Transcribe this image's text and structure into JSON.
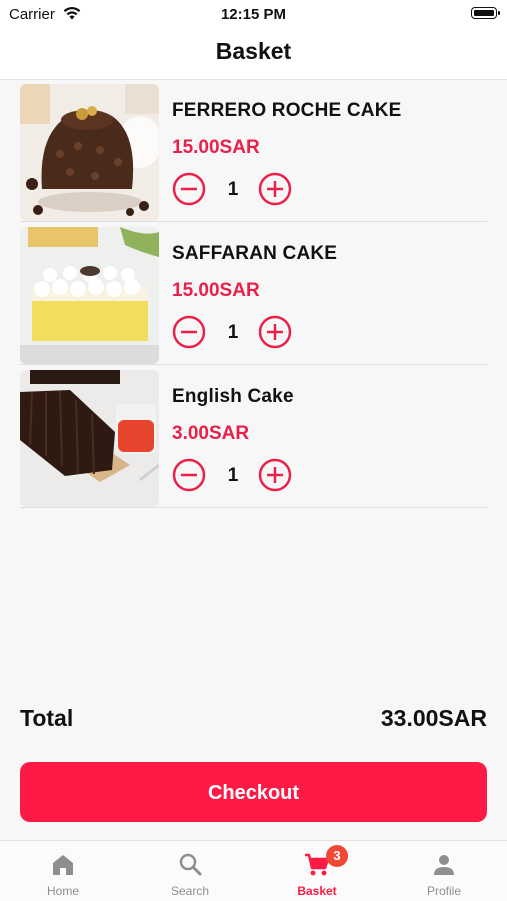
{
  "status_bar": {
    "carrier": "Carrier",
    "time": "12:15 PM"
  },
  "header": {
    "title": "Basket"
  },
  "basket": {
    "items": [
      {
        "name": "FERRERO ROCHE CAKE",
        "price": "15.00SAR",
        "quantity": "1"
      },
      {
        "name": "SAFFARAN CAKE",
        "price": "15.00SAR",
        "quantity": "1"
      },
      {
        "name": "English Cake",
        "price": "3.00SAR",
        "quantity": "1"
      }
    ],
    "total_label": "Total",
    "total_value": "33.00SAR",
    "checkout_label": "Checkout"
  },
  "tabs": {
    "home": {
      "label": "Home",
      "icon": "home-icon"
    },
    "search": {
      "label": "Search",
      "icon": "search-icon"
    },
    "basket": {
      "label": "Basket",
      "icon": "cart-icon",
      "badge": "3"
    },
    "profile": {
      "label": "Profile",
      "icon": "person-icon"
    }
  },
  "colors": {
    "accent": "#fd1a45",
    "badge": "#f04835",
    "inactive_tab": "#8e8e8e"
  }
}
